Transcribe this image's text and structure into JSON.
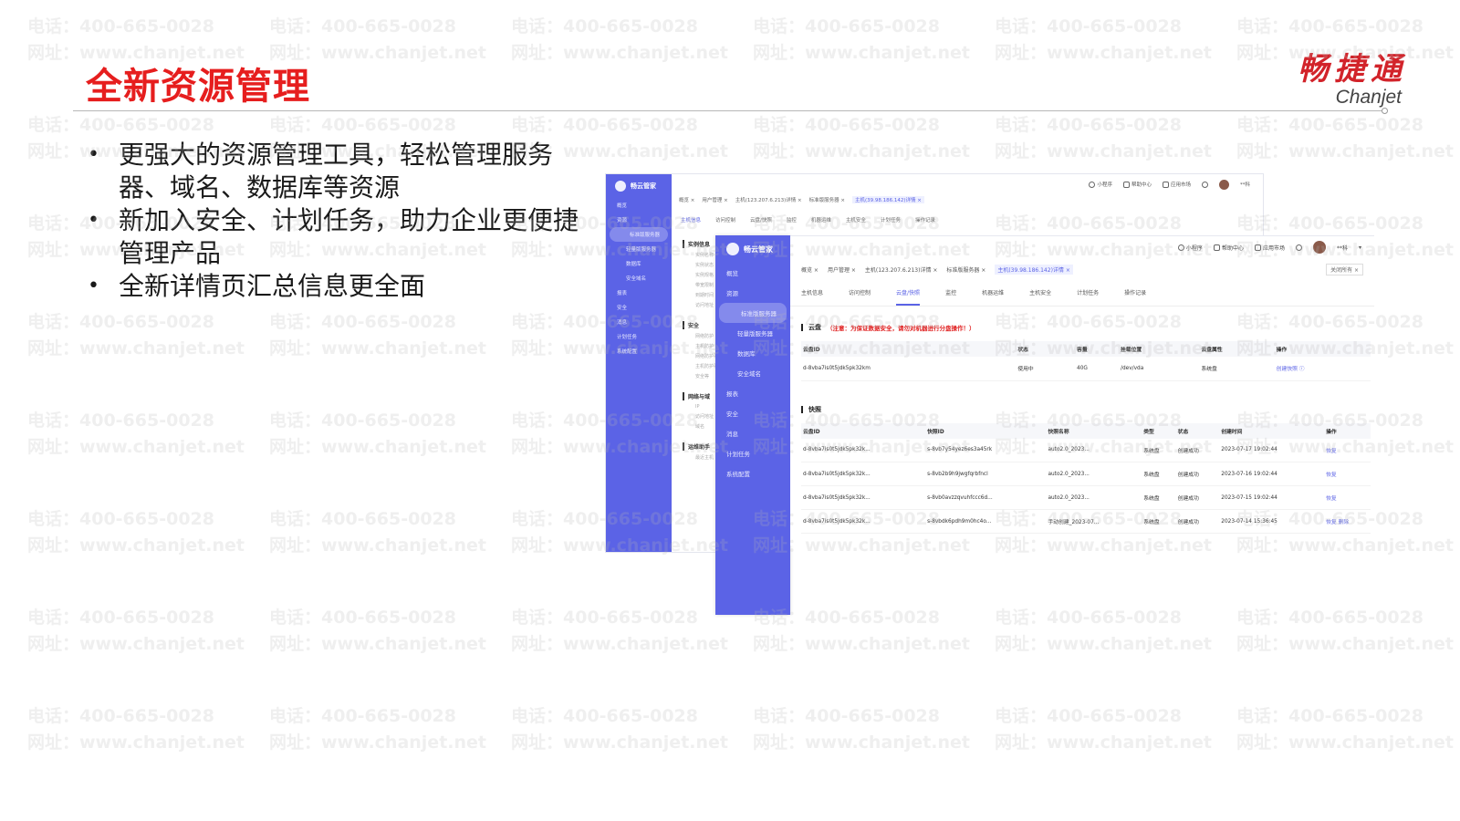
{
  "slide": {
    "title": "全新资源管理",
    "brand_cn": "畅捷通",
    "brand_en": "Chanjet"
  },
  "watermark": {
    "phone": "电话：400-665-0028",
    "site": "网址：www.chanjet.net"
  },
  "bullets": [
    "更强大的资源管理工具，轻松管理服务器、域名、数据库等资源",
    "新加入安全、计划任务，助力企业更便捷管理产品",
    "全新详情页汇总信息更全面"
  ],
  "bullet_symbol": "•",
  "app": {
    "logo": "畅云管家",
    "sidebar": [
      {
        "label": "概览",
        "type": "item"
      },
      {
        "label": "资源",
        "type": "item"
      },
      {
        "label": "标准版服务器",
        "type": "sub-active"
      },
      {
        "label": "轻量版服务器",
        "type": "sub"
      },
      {
        "label": "数据库",
        "type": "sub"
      },
      {
        "label": "安全域名",
        "type": "sub"
      },
      {
        "label": "报表",
        "type": "item"
      },
      {
        "label": "安全",
        "type": "item"
      },
      {
        "label": "消息",
        "type": "item"
      },
      {
        "label": "计划任务",
        "type": "item"
      },
      {
        "label": "系统配置",
        "type": "item"
      }
    ],
    "topbar": [
      "小程序",
      "帮助中心",
      "应用市场"
    ],
    "user": "**科",
    "tabs": [
      "概览",
      "用户管理",
      "主机(123.207.6.213)详情",
      "标准版服务器",
      "主机(39.98.186.142)详情"
    ],
    "close_all": "关闭所有",
    "back_close_all": "关闭所有",
    "subtabs": [
      "主机信息",
      "访问控制",
      "云盘/快照",
      "监控",
      "机器运维",
      "主机安全",
      "计划任务",
      "操作记录"
    ],
    "back_sections": [
      {
        "title": "实例信息",
        "fields": [
          "实例名称",
          "实例状态",
          "实例规格",
          "带宽限制",
          "到期时间",
          "访问地址"
        ]
      },
      {
        "title": "安全",
        "fields": [
          "网络防护",
          "主机防护",
          "网络防护事",
          "主机防护事",
          "安全等"
        ]
      },
      {
        "title": "网络与域",
        "fields": [
          "IP",
          "访问地址",
          "域名"
        ]
      },
      {
        "title": "运维助手",
        "fields": [
          "最近主机"
        ]
      }
    ]
  },
  "disk_panel": {
    "title": "云盘",
    "warning": "（注意：为保证数据安全，请勿对机器进行分盘操作！）",
    "columns": [
      "云盘ID",
      "状态",
      "容量",
      "挂载位置",
      "云盘属性",
      "操作"
    ],
    "rows": [
      [
        "d-8vba7is0t5jdk5pk32km",
        "使用中",
        "40G",
        "/dev/vda",
        "系统盘",
        "创建快照 ⓘ"
      ]
    ]
  },
  "snapshot_panel": {
    "title": "快照",
    "columns": [
      "云盘ID",
      "快照ID",
      "快照名称",
      "类型",
      "状态",
      "创建时间",
      "操作"
    ],
    "rows": [
      [
        "d-8vba7is0t5jdk5pk32k...",
        "s-8vb7y54yez6es3a45rk",
        "auto2.0_2023...",
        "系统盘",
        "创建成功",
        "2023-07-17 19:02:44",
        "恢复",
        ""
      ],
      [
        "d-8vba7is0t5jdk5pk32k...",
        "s-8vb2b9h9jwgfqrbfncl",
        "auto2.0_2023...",
        "系统盘",
        "创建成功",
        "2023-07-16 19:02:44",
        "恢复",
        ""
      ],
      [
        "d-8vba7is0t5jdk5pk32k...",
        "s-8vb0avzzqvuhfccc6d...",
        "auto2.0_2023...",
        "系统盘",
        "创建成功",
        "2023-07-15 19:02:44",
        "恢复",
        ""
      ],
      [
        "d-8vba7is0t5jdk5pk32k...",
        "s-8vbdk6pdh9m0hc4o...",
        "手动创建_2023-07...",
        "系统盘",
        "创建成功",
        "2023-07-14 15:36:45",
        "恢复",
        "删除"
      ]
    ]
  }
}
